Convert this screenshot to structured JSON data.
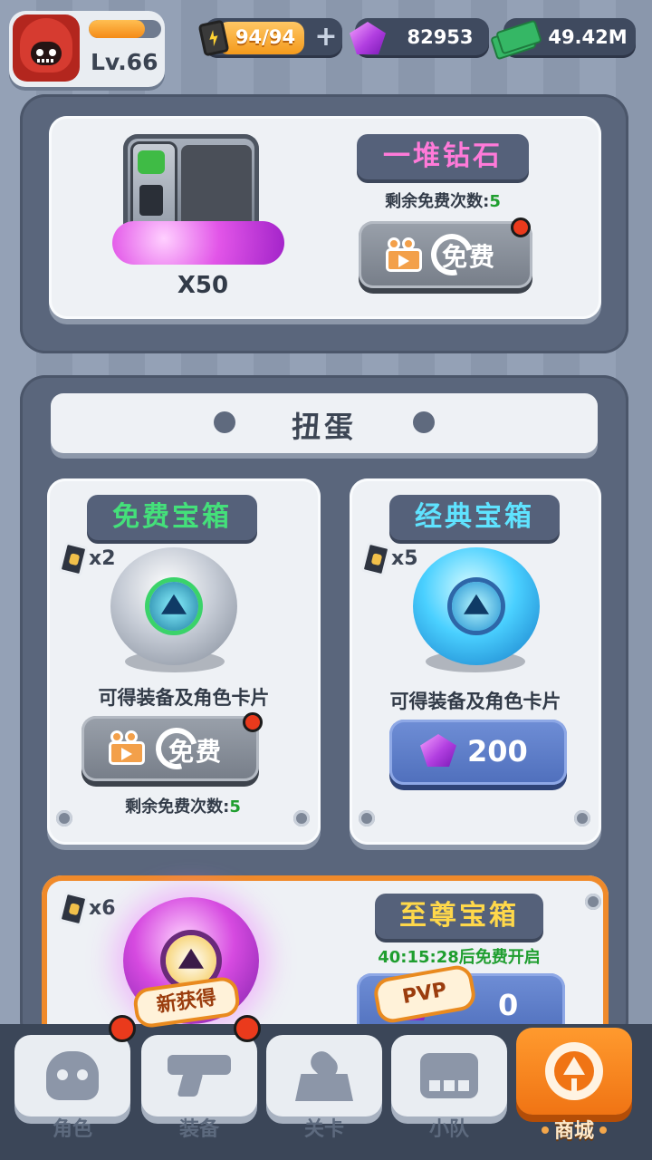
{
  "topbar": {
    "level": "Lv.66",
    "xp_fraction": 0.78,
    "energy": "94/94",
    "energy_plus": "+",
    "gems": "82953",
    "cash": "49.42M"
  },
  "diamond_offer": {
    "title": "一堆钻石",
    "quantity": "X50",
    "remaining_label": "剩余免费次数:",
    "remaining_count": "5",
    "button_label": "免费"
  },
  "gacha": {
    "header": "扭蛋",
    "free_chest": {
      "title": "免费宝箱",
      "cards": "x2",
      "desc": "可得装备及角色卡片",
      "button_label": "免费",
      "remaining_label": "剩余免费次数:",
      "remaining_count": "5"
    },
    "classic_chest": {
      "title": "经典宝箱",
      "cards": "x5",
      "desc": "可得装备及角色卡片",
      "price": "200"
    },
    "supreme_chest": {
      "title": "至尊宝箱",
      "cards": "x6",
      "timer": "40:15:28后免费开启",
      "price_partial": "0"
    }
  },
  "badges": {
    "new": "新获得",
    "pvp": "PVP"
  },
  "nav": [
    {
      "label": "角色",
      "icon": "skull-icon"
    },
    {
      "label": "装备",
      "icon": "gun-icon"
    },
    {
      "label": "关卡",
      "icon": "map-pin-icon"
    },
    {
      "label": "小队",
      "icon": "team-icon"
    },
    {
      "label": "商城",
      "icon": "shop-icon"
    }
  ],
  "colors": {
    "accent_orange": "#f07414",
    "title_pink": "#ff7ad9",
    "title_green": "#44e07a",
    "title_cyan": "#5fe3ff",
    "title_yellow": "#ffd84a"
  }
}
